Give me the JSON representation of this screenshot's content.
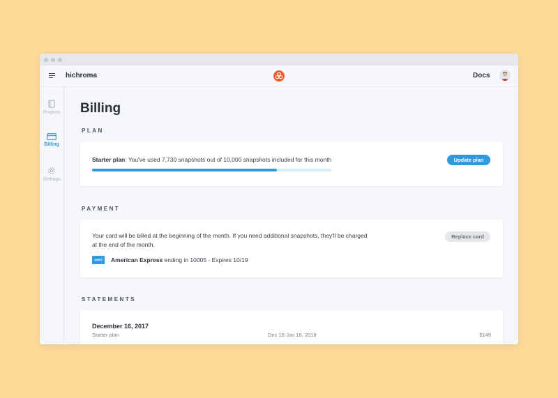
{
  "app": {
    "brand": "hichroma",
    "docs_label": "Docs"
  },
  "sidebar": {
    "items": [
      {
        "label": "Projects",
        "icon": "book-icon",
        "active": false
      },
      {
        "label": "Billing",
        "icon": "credit-card-icon",
        "active": true
      },
      {
        "label": "Settings",
        "icon": "gear-icon",
        "active": false
      }
    ]
  },
  "page": {
    "title": "Billing"
  },
  "plan": {
    "section_title": "PLAN",
    "plan_name": "Starter plan",
    "usage_text": ": You've used 7,730 snapshots out of 10,000 snapshots included for this month",
    "usage_fraction": 0.773,
    "update_button": "Update plan"
  },
  "payment": {
    "section_title": "PAYMENT",
    "description": "Your card will be billed at the beginning of the month. If you need additional snapshots, they'll be charged at the end of the month.",
    "card_badge": "AMEX",
    "card_brand": "American Express",
    "card_details": " ending in 10005 - Expires 10/19",
    "replace_button": "Replace card"
  },
  "statements": {
    "section_title": "STATEMENTS",
    "items": [
      {
        "date": "December 16, 2017",
        "plan": "Starter plan",
        "range": "Dec 16-Jan 16, 2018",
        "amount": "$149"
      }
    ]
  },
  "colors": {
    "accent": "#2f9ae0",
    "background": "#fdd998",
    "logo": "#f05a28"
  }
}
